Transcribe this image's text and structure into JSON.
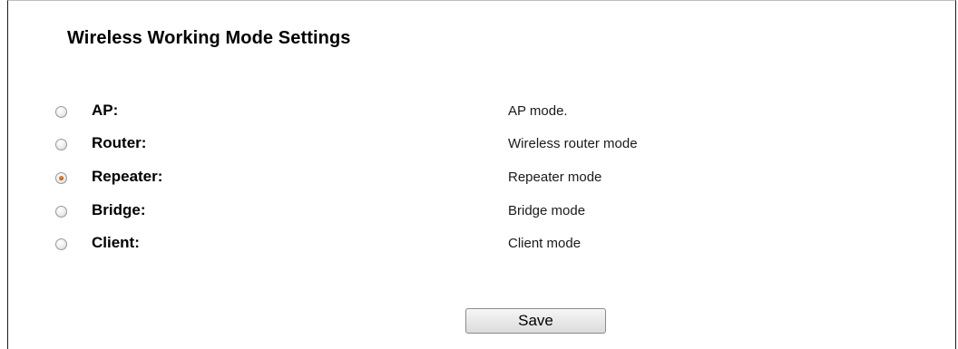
{
  "page": {
    "title": "Wireless Working Mode Settings"
  },
  "modes": [
    {
      "label": "AP:",
      "description": "AP mode.",
      "selected": false
    },
    {
      "label": "Router:",
      "description": "Wireless router mode",
      "selected": false
    },
    {
      "label": "Repeater:",
      "description": "Repeater mode",
      "selected": true
    },
    {
      "label": "Bridge:",
      "description": "Bridge mode",
      "selected": false
    },
    {
      "label": "Client:",
      "description": "Client mode",
      "selected": false
    }
  ],
  "actions": {
    "save_label": "Save"
  },
  "colors": {
    "selected_radio_dot": "#b85a10",
    "border": "#1a1a1a"
  }
}
